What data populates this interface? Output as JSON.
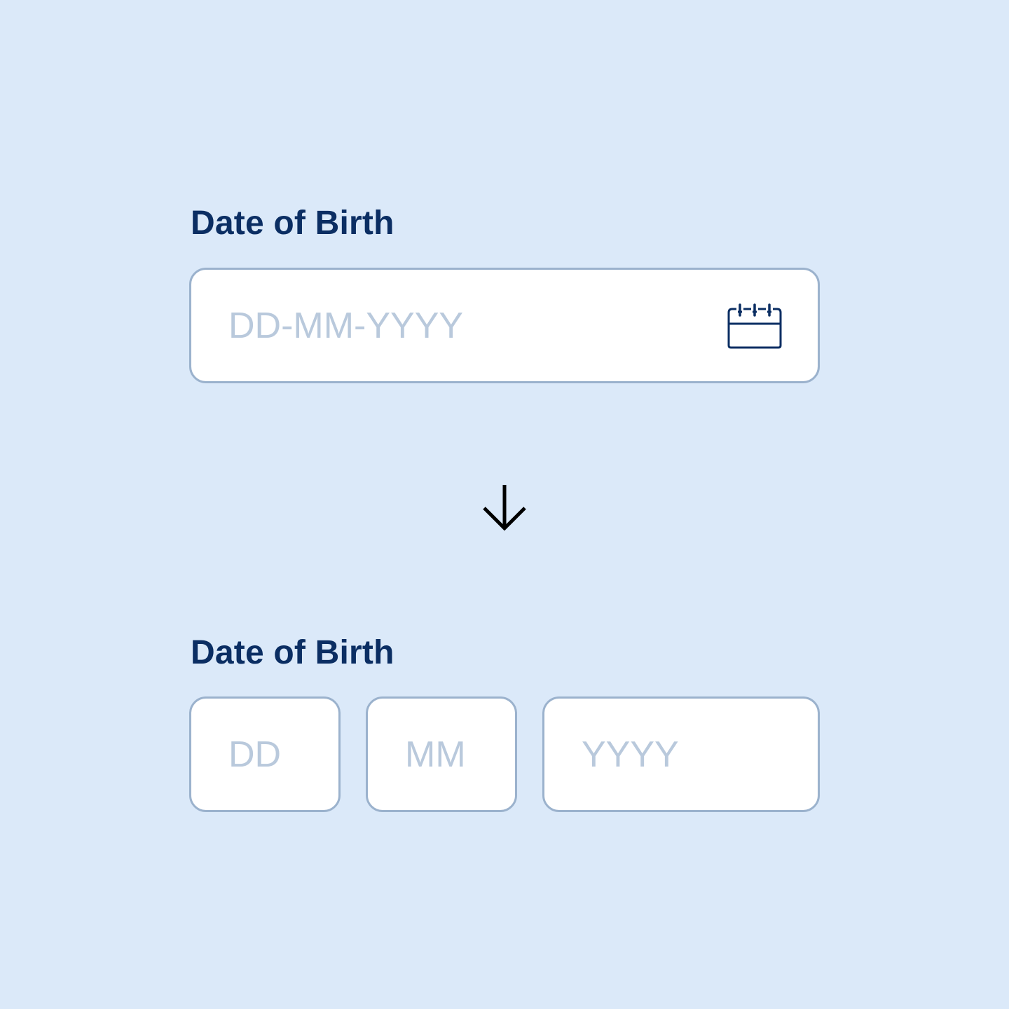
{
  "colors": {
    "background": "#dbe9f9",
    "label": "#0b2e63",
    "field_background": "#ffffff",
    "field_border": "#9bb2cd",
    "placeholder": "#b9c9dc",
    "icon": "#0b2e63",
    "arrow": "#000000"
  },
  "single_field": {
    "label": "Date of Birth",
    "placeholder": "DD-MM-YYYY",
    "value": "",
    "icon": "calendar-icon"
  },
  "transition": {
    "icon": "arrow-down-icon"
  },
  "split_fields": {
    "label": "Date of Birth",
    "day": {
      "placeholder": "DD",
      "value": ""
    },
    "month": {
      "placeholder": "MM",
      "value": ""
    },
    "year": {
      "placeholder": "YYYY",
      "value": ""
    }
  }
}
